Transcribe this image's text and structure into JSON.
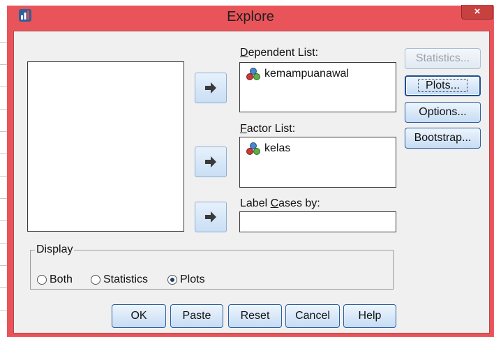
{
  "window": {
    "title": "Explore",
    "close_glyph": "×"
  },
  "dependent_list": {
    "label": "Dependent List:",
    "label_access_key": "D",
    "items": [
      {
        "icon": "scale-variable-icon",
        "text": "kemampuanawal"
      }
    ]
  },
  "factor_list": {
    "label": "Factor List:",
    "label_access_key": "F",
    "items": [
      {
        "icon": "scale-variable-icon",
        "text": "kelas"
      }
    ]
  },
  "label_cases": {
    "label_prefix": "Label ",
    "label_key": "C",
    "label_suffix": "ases by:",
    "value": ""
  },
  "side_buttons": {
    "statistics": "Statistics...",
    "plots": "Plots...",
    "options": "Options...",
    "bootstrap": "Bootstrap..."
  },
  "display": {
    "title": "Display",
    "options": [
      {
        "label": "Both",
        "selected": false
      },
      {
        "label": "Statistics",
        "selected": false
      },
      {
        "label": "Plots",
        "selected": true
      }
    ]
  },
  "buttons": {
    "ok": "OK",
    "paste": "Paste",
    "reset": "Reset",
    "cancel": "Cancel",
    "help": "Help"
  },
  "colors": {
    "frame": "#e9545a",
    "client": "#f0f0f0",
    "button_border": "#2b5f9e"
  }
}
